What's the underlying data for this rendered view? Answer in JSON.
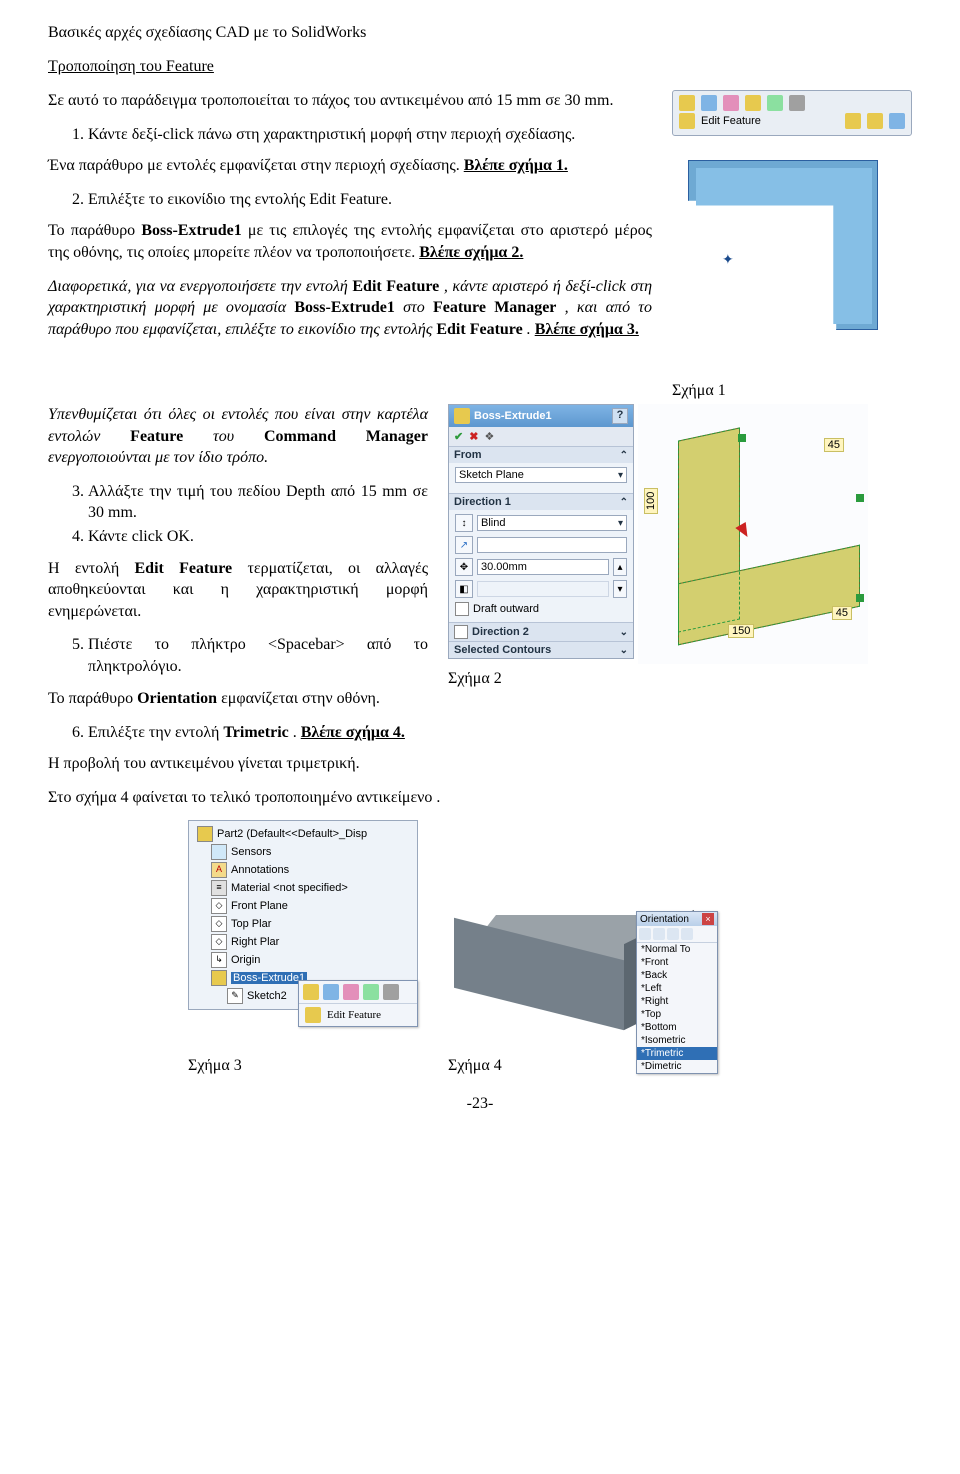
{
  "page": {
    "header": "Βασικές αρχές σχεδίασης CAD με το SolidWorks",
    "section_title": "Τροποποίηση του Feature",
    "footer": "-23-"
  },
  "text": {
    "intro": "Σε αυτό το παράδειγμα τροποποιείται το πάχος του αντικειμένου από 15 mm σε 30 mm.",
    "step1": "Κάντε δεξί-click πάνω στη χαρακτηριστική μορφή στην περιοχή σχεδίασης.",
    "after1a": "Ένα παράθυρο με εντολές εμφανίζεται στην περιοχή σχεδίασης. ",
    "after1b": "Βλέπε σχήμα 1.",
    "step2": "Επιλέξτε το εικονίδιο της εντολής Edit Feature.",
    "after2a": "Το παράθυρο ",
    "after2b": "Boss-Extrude1",
    "after2c": " με τις επιλογές της εντολής εμφανίζεται στο αριστερό μέρος της οθόνης, τις οποίες μπορείτε πλέον να τροποποιήσετε. ",
    "after2d": "Βλέπε σχήμα 2.",
    "alt_a": "Διαφορετικά, για να ενεργοποιήσετε την εντολή ",
    "alt_b": "Edit Feature",
    "alt_c": ", κάντε αριστερό ή δεξί-click στη χαρακτηριστική μορφή με ονομασία ",
    "alt_d": "Boss-Extrude1",
    "alt_e": " στο ",
    "alt_f": "Feature Manager",
    "alt_g": ", και από το παράθυρο που εμφανίζεται, επιλέξτε το εικονίδιο της εντολής ",
    "alt_h": "Edit Feature",
    "alt_i": ". ",
    "alt_j": "Βλέπε σχήμα 3.",
    "note_a": "Υπενθυμίζεται ότι όλες οι εντολές που είναι στην καρτέλα εντολών ",
    "note_b": "Feature",
    "note_c": " του ",
    "note_d": "Command Manager",
    "note_e": " ενεργοποιούνται με τον ίδιο τρόπο.",
    "step3": "Αλλάξτε την τιμή του πεδίου Depth από 15 mm σε 30 mm.",
    "step4": "Κάντε click OK.",
    "after4_a": "Η εντολή ",
    "after4_b": "Edit Feature",
    "after4_c": " τερματίζεται, οι αλλαγές αποθηκεύονται και η χαρακτηριστική μορφή ενημερώνεται.",
    "step5": "Πιέστε το πλήκτρο <Spacebar> από το πληκτρολόγιο.",
    "after5_a": "Το παράθυρο ",
    "after5_b": "Orientation",
    "after5_c": " εμφανίζεται στην οθόνη.",
    "step6_a": "Επιλέξτε την εντολή ",
    "step6_b": "Trimetric",
    "step6_c": ". ",
    "step6_d": "Βλέπε σχήμα 4.",
    "after6": "Η προβολή του αντικειμένου γίνεται τριμετρική.",
    "final": "Στο σχήμα 4 φαίνεται το τελικό τροποποιημένο αντικείμενο ."
  },
  "labels": {
    "fig1": "Σχήμα 1",
    "fig2": "Σχήμα 2",
    "fig3": "Σχήμα 3",
    "fig4": "Σχήμα 4"
  },
  "fig1_toolbar": {
    "label": "Edit Feature"
  },
  "pm": {
    "title": "Boss-Extrude1",
    "help": "?",
    "from_h": "From",
    "from_val": "Sketch Plane",
    "dir1_h": "Direction 1",
    "blind": "Blind",
    "depth": "30.00mm",
    "draft_label": "Draft outward",
    "dir2_h": "Direction 2",
    "sel_h": "Selected Contours"
  },
  "dims": {
    "d45": "45",
    "d100": "100",
    "d150": "150"
  },
  "tree": {
    "root": "Part2 (Default<<Default>_Disp",
    "sensors": "Sensors",
    "annot": "Annotations",
    "material": "Material <not specified>",
    "front": "Front Plane",
    "top": "Top Plar",
    "right": "Right Plar",
    "origin": "Origin",
    "boss": "Boss-Extrude1",
    "sketch": "Sketch2",
    "ctx_label": "Edit Feature"
  },
  "orient": {
    "title": "Orientation",
    "items": [
      "*Normal To",
      "*Front",
      "*Back",
      "*Left",
      "*Right",
      "*Top",
      "*Bottom",
      "*Isometric",
      "*Trimetric",
      "*Dimetric"
    ],
    "selected": "*Trimetric"
  }
}
